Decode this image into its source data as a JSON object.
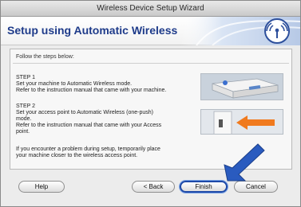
{
  "window": {
    "title": "Wireless Device Setup Wizard"
  },
  "header": {
    "title": "Setup using Automatic Wireless"
  },
  "instructions": {
    "follow": "Follow the steps below:"
  },
  "steps": [
    {
      "label": "STEP 1",
      "lines": [
        "Set your machine to Automatic Wireless mode.",
        "Refer to the instruction manual that came with your machine."
      ]
    },
    {
      "label": "STEP 2",
      "lines": [
        "Set your access point to Automatic Wireless (one-push)",
        "mode.",
        "Refer to the instruction manual that came with your Access",
        "point."
      ]
    }
  ],
  "note": {
    "lines": [
      "If you encounter a problem during setup, temporarily place",
      "your machine closer to the wireless access point."
    ]
  },
  "buttons": {
    "help": "Help",
    "back": "< Back",
    "finish": "Finish",
    "cancel": "Cancel"
  },
  "colors": {
    "title_blue": "#1e3b8a",
    "arrow_blue": "#2a5bbf",
    "arrow_orange": "#f07a1e"
  },
  "icons": {
    "wireless": "wireless-signal-icon",
    "pointer": "blue-arrow-icon",
    "access_point_arrow": "orange-arrow-icon"
  }
}
